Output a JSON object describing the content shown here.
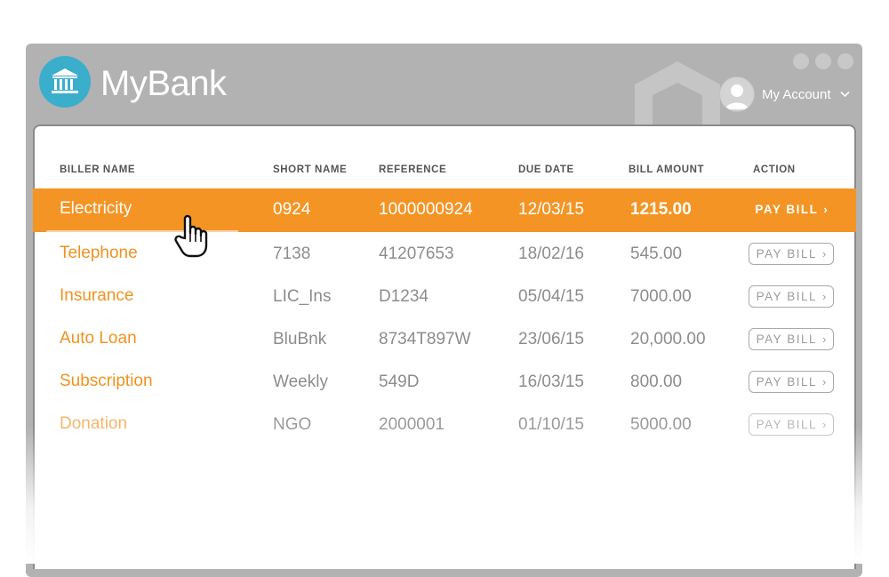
{
  "app": {
    "brand": "MyBank"
  },
  "account": {
    "label": "My Account"
  },
  "columns": [
    "BILLER NAME",
    "SHORT NAME",
    "REFERENCE",
    "DUE DATE",
    "BILL AMOUNT",
    "ACTION"
  ],
  "rows": [
    {
      "biller": "Electricity",
      "short": "0924",
      "reference": "1000000924",
      "due": "12/03/15",
      "amount": "1215.00",
      "action": "PAY BILL",
      "state": "active"
    },
    {
      "biller": "Telephone",
      "short": "7138",
      "reference": "41207653",
      "due": "18/02/16",
      "amount": "545.00",
      "action": "PAY BILL",
      "state": "normal"
    },
    {
      "biller": "Insurance",
      "short": "LIC_Ins",
      "reference": "D1234",
      "due": "05/04/15",
      "amount": "7000.00",
      "action": "PAY BILL",
      "state": "normal"
    },
    {
      "biller": "Auto Loan",
      "short": "BluBnk",
      "reference": "8734T897W",
      "due": "23/06/15",
      "amount": "20,000.00",
      "action": "PAY BILL",
      "state": "normal"
    },
    {
      "biller": "Subscription",
      "short": "Weekly",
      "reference": "549D",
      "due": "16/03/15",
      "amount": "800.00",
      "action": "PAY BILL",
      "state": "normal"
    },
    {
      "biller": "Donation",
      "short": "NGO",
      "reference": "2000001",
      "due": "01/10/15",
      "amount": "5000.00",
      "action": "PAY BILL",
      "state": "faded"
    }
  ],
  "icons": {
    "logo": "bank-building-icon",
    "avatar": "user-avatar-icon",
    "dropdown": "chevron-down-icon",
    "pay_arrow": "chevron-right-icon",
    "cursor": "hand-pointer-icon"
  },
  "colors": {
    "accent": "#f39424",
    "logo": "#3aaecb",
    "chrome": "#b2b2b2"
  }
}
